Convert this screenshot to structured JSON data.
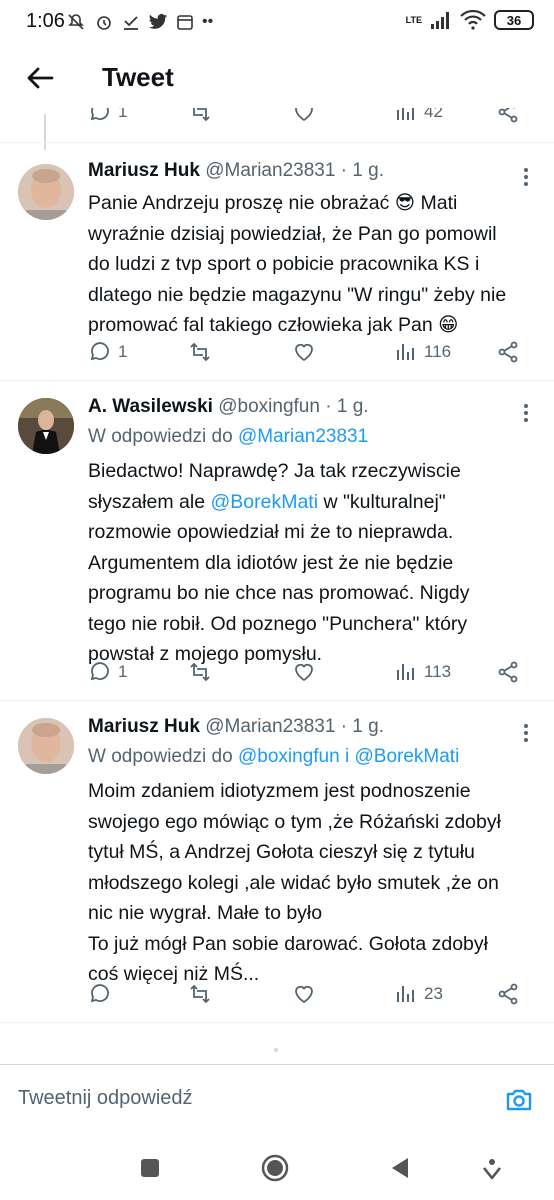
{
  "status_bar": {
    "time": "1:06",
    "network": "LTE",
    "battery": "36"
  },
  "header": {
    "title": "Tweet"
  },
  "top_actions": {
    "replies": "1",
    "views": "42"
  },
  "tweets": [
    {
      "name": "Mariusz Huk",
      "handle": "@Marian23831",
      "dot": "·",
      "time": "1 g.",
      "reply_prefix": "",
      "mentions": [],
      "lines": [
        "Panie Andrzeju proszę nie obrażać 😎 Mati",
        "wyraźnie dzisiaj powiedział, że Pan go pomowil",
        "do ludzi z tvp sport o pobicie pracownika KS i",
        "dlatego nie będzie magazynu \"W ringu\" żeby nie",
        "promować fal takiego człowieka jak Pan 😁"
      ],
      "replies": "1",
      "views": "116"
    },
    {
      "name": "A. Wasilewski",
      "handle": "@boxingfun",
      "dot": "·",
      "time": "1 g.",
      "reply_prefix": "W odpowiedzi do",
      "mentions": [
        "@Marian23831"
      ],
      "line1_pre": "Biedactwo! Naprawdę? Ja tak rzeczywiscie",
      "line2_pre": "słyszałem ale",
      "line2_mention": "@BorekMati",
      "line2_post": "w \"kulturalnej\"",
      "lines": [
        "rozmowie opowiedział mi że to nieprawda.",
        "Argumentem dla idiotów jest że nie będzie",
        "programu bo nie chce nas promować. Nigdy",
        "tego nie robił. Od poznego \"Punchera\" który",
        "powstał z mojego pomysłu."
      ],
      "replies": "1",
      "views": "113"
    },
    {
      "name": "Mariusz Huk",
      "handle": "@Marian23831",
      "dot": "·",
      "time": "1 g.",
      "reply_prefix": "W odpowiedzi do",
      "mention1": "@boxingfun",
      "joiner": "i",
      "mention2": "@BorekMati",
      "lines": [
        "Moim zdaniem idiotyzmem jest podnoszenie",
        "swojego ego mówiąc o tym ,że Różański zdobył",
        "tytuł MŚ, a Andrzej Gołota cieszył się z tytułu",
        "młodszego kolegi ,ale widać było smutek ,że on",
        "nic nie wygrał. Małe to było",
        "To już mógł Pan sobie darować. Gołota zdobył",
        "coś więcej niż MŚ..."
      ],
      "replies": "",
      "views": "23"
    }
  ],
  "compose": {
    "placeholder": "Tweetnij odpowiedź"
  },
  "colors": {
    "accent": "#1d9bf0",
    "secondary_text": "#536471",
    "thread_line": "#cfd9de"
  }
}
